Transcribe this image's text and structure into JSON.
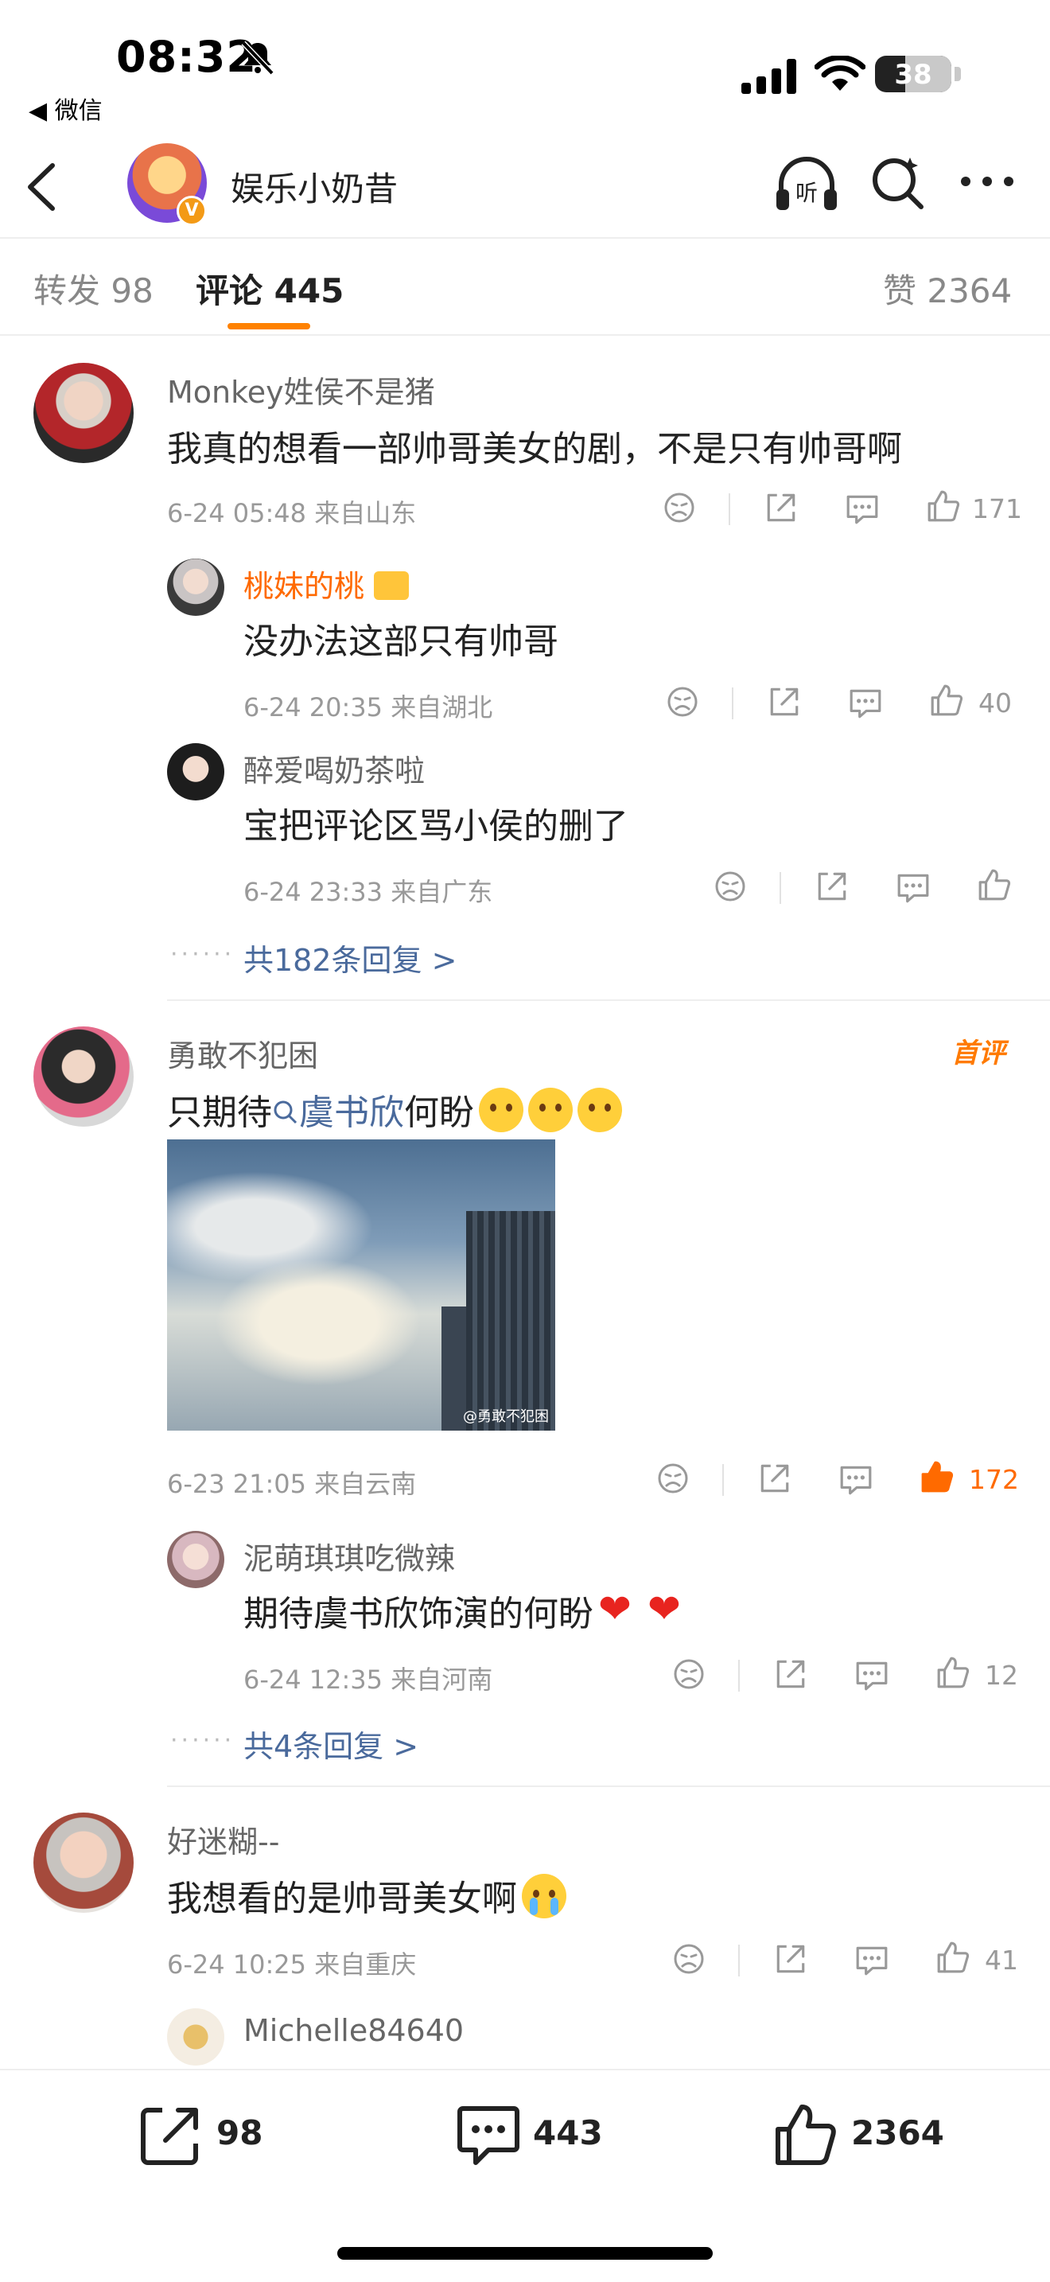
{
  "status_bar": {
    "time": "08:32",
    "back_app": "◀ 微信",
    "battery": "38"
  },
  "header": {
    "title": "娱乐小奶昔",
    "badge": "V"
  },
  "tabs": [
    {
      "label": "转发 98"
    },
    {
      "label": "评论 445"
    },
    {
      "label": "赞 2364"
    }
  ],
  "comments": [
    {
      "user": "Monkey姓侯不是猪",
      "text": "我真的想看一部帅哥美女的剧，不是只有帅哥啊",
      "meta": "6-24 05:48  来自山东",
      "likes": "171",
      "replies": [
        {
          "user": "桃妹的桃",
          "text": "没办法这部只有帅哥",
          "meta": "6-24 20:35  来自湖北",
          "likes": "40"
        },
        {
          "user": "醉爱喝奶茶啦",
          "text": "宝把评论区骂小侯的删了",
          "meta": "6-24 23:33  来自广东",
          "likes": ""
        }
      ],
      "more": "共182条回复 >"
    },
    {
      "user": "勇敢不犯困",
      "badge": "首评",
      "text_prefix": "只期待",
      "link": "虞书欣",
      "text_suffix": "何盼",
      "meta": "6-23 21:05  来自云南",
      "likes": "172",
      "image_watermark": "@勇敢不犯困",
      "replies": [
        {
          "user": "泥萌琪琪吃微辣",
          "text": "期待虞书欣饰演的何盼",
          "meta": "6-24 12:35  来自河南",
          "likes": "12"
        }
      ],
      "more": "共4条回复 >"
    },
    {
      "user": "好迷糊--",
      "text": "我想看的是帅哥美女啊",
      "meta": "6-24 10:25  来自重庆",
      "likes": "41",
      "replies": [
        {
          "user": "Michelle84640"
        }
      ]
    }
  ],
  "bottom_bar": {
    "reposts": "98",
    "comments": "443",
    "likes": "2364"
  },
  "colors": {
    "accent": "#ff8200",
    "link": "#4a6a9c",
    "liked": "#ff6a00"
  }
}
